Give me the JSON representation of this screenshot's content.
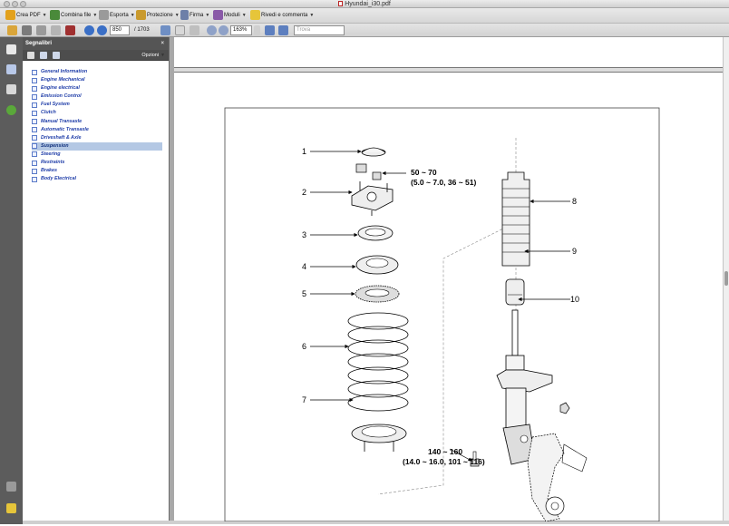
{
  "window": {
    "title": "Hyundai_i30.pdf"
  },
  "toolbar": {
    "create_pdf": "Crea PDF",
    "combine": "Combina file",
    "export": "Esporta",
    "protect": "Protezione",
    "sign": "Firma",
    "forms": "Moduli",
    "review": "Rivedi e commenta"
  },
  "nav": {
    "current_page": "850",
    "total_pages": "/ 1703",
    "zoom": "163%",
    "search_placeholder": "Trova"
  },
  "bookmarks": {
    "title": "Segnalibri",
    "close": "×",
    "options": "Opzioni",
    "items": [
      {
        "label": "General Information"
      },
      {
        "label": "Engine Mechanical"
      },
      {
        "label": "Engine electrical"
      },
      {
        "label": "Emission Control"
      },
      {
        "label": "Fuel System"
      },
      {
        "label": "Clutch"
      },
      {
        "label": "Manual Transaxle"
      },
      {
        "label": "Automatic Transaxle"
      },
      {
        "label": "Driveshaft & Axle"
      },
      {
        "label": "Suspension",
        "selected": true
      },
      {
        "label": "Steering"
      },
      {
        "label": "Restraints"
      },
      {
        "label": "Brakes"
      },
      {
        "label": "Body Electrical"
      }
    ]
  },
  "diagram": {
    "labels": {
      "n1": "1",
      "n2": "2",
      "n3": "3",
      "n4": "4",
      "n5": "5",
      "n6": "6",
      "n7": "7",
      "n8": "8",
      "n9": "9",
      "n10": "10"
    },
    "torque_top": {
      "line1": "50 ~ 70",
      "line2": "(5.0 ~ 7.0, 36 ~ 51)"
    },
    "torque_bottom": {
      "line1": "140 ~ 160",
      "line2": "(14.0 ~ 16.0, 101 ~ 116)"
    }
  },
  "colors": {
    "panel_header": "#555555",
    "bookmark_text": "#1f3da8",
    "selected_bg": "#b4c8e4"
  }
}
